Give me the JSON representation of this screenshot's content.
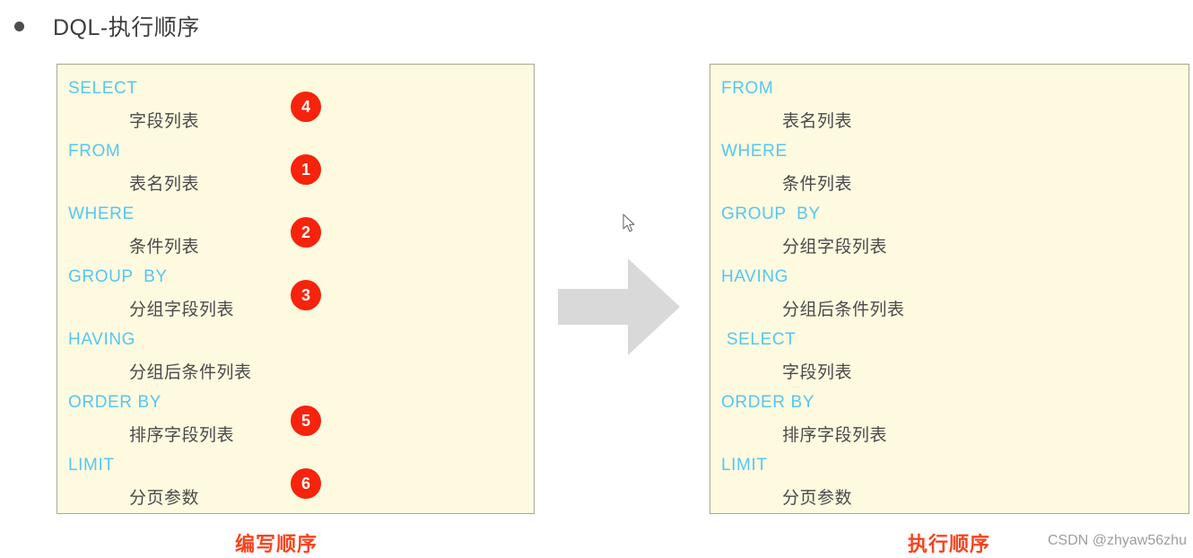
{
  "heading": {
    "bullet": "●",
    "title": "DQL-执行顺序"
  },
  "colors": {
    "panel_background": "#fdfae0",
    "panel_border": "#a8a893",
    "keyword": "#56c6f2",
    "description": "#4a4a4a",
    "badge": "#f7230c",
    "caption": "#f9421d",
    "arrow": "#d9d9d9",
    "watermark": "#9e9e9e"
  },
  "left_panel": {
    "caption": "编写顺序",
    "rows": [
      {
        "keyword": "SELECT",
        "description": "字段列表",
        "badge": "4"
      },
      {
        "keyword": "FROM",
        "description": "表名列表",
        "badge": "1"
      },
      {
        "keyword": "WHERE",
        "description": "条件列表",
        "badge": "2"
      },
      {
        "keyword": "GROUP  BY",
        "description": "分组字段列表",
        "badge": "3"
      },
      {
        "keyword": "HAVING",
        "description": "分组后条件列表",
        "badge": ""
      },
      {
        "keyword": "ORDER BY",
        "description": "排序字段列表",
        "badge": "5"
      },
      {
        "keyword": "LIMIT",
        "description": "分页参数",
        "badge": "6"
      }
    ]
  },
  "right_panel": {
    "caption": "执行顺序",
    "rows": [
      {
        "keyword": "FROM",
        "description": "表名列表"
      },
      {
        "keyword": "WHERE",
        "description": "条件列表"
      },
      {
        "keyword": "GROUP  BY",
        "description": "分组字段列表"
      },
      {
        "keyword": "HAVING",
        "description": "分组后条件列表"
      },
      {
        "keyword": " SELECT",
        "description": "字段列表"
      },
      {
        "keyword": "ORDER BY",
        "description": "排序字段列表"
      },
      {
        "keyword": "LIMIT",
        "description": "分页参数"
      }
    ]
  },
  "arrow": {
    "icon": "arrow-right-block"
  },
  "cursor": {
    "icon": "mouse-pointer"
  },
  "watermark": {
    "text": "CSDN @zhyaw56zhu"
  }
}
